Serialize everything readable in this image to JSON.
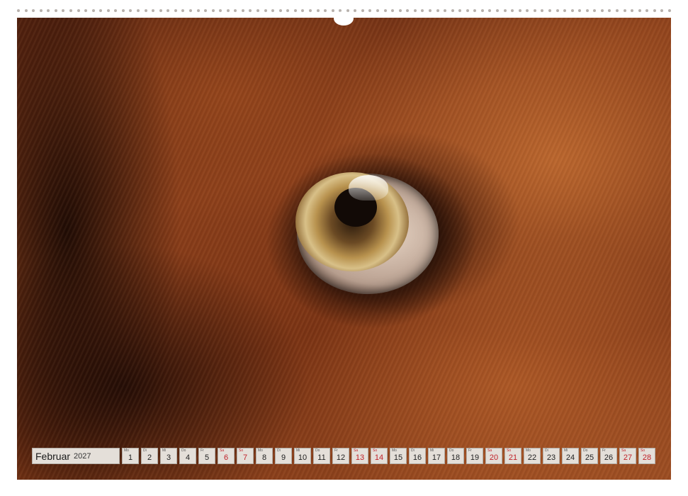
{
  "calendar": {
    "month": "Februar",
    "year": "2027",
    "weekend_color": "#c0222a",
    "days": [
      {
        "wd": "Mo",
        "num": "1",
        "weekend": false
      },
      {
        "wd": "Di",
        "num": "2",
        "weekend": false
      },
      {
        "wd": "Mi",
        "num": "3",
        "weekend": false
      },
      {
        "wd": "Do",
        "num": "4",
        "weekend": false
      },
      {
        "wd": "Fr",
        "num": "5",
        "weekend": false
      },
      {
        "wd": "Sa",
        "num": "6",
        "weekend": true
      },
      {
        "wd": "So",
        "num": "7",
        "weekend": true
      },
      {
        "wd": "Mo",
        "num": "8",
        "weekend": false
      },
      {
        "wd": "Di",
        "num": "9",
        "weekend": false
      },
      {
        "wd": "Mi",
        "num": "10",
        "weekend": false
      },
      {
        "wd": "Do",
        "num": "11",
        "weekend": false
      },
      {
        "wd": "Fr",
        "num": "12",
        "weekend": false
      },
      {
        "wd": "Sa",
        "num": "13",
        "weekend": true
      },
      {
        "wd": "So",
        "num": "14",
        "weekend": true
      },
      {
        "wd": "Mo",
        "num": "15",
        "weekend": false
      },
      {
        "wd": "Di",
        "num": "16",
        "weekend": false
      },
      {
        "wd": "Mi",
        "num": "17",
        "weekend": false
      },
      {
        "wd": "Do",
        "num": "18",
        "weekend": false
      },
      {
        "wd": "Fr",
        "num": "19",
        "weekend": false
      },
      {
        "wd": "Sa",
        "num": "20",
        "weekend": true
      },
      {
        "wd": "So",
        "num": "21",
        "weekend": true
      },
      {
        "wd": "Mo",
        "num": "22",
        "weekend": false
      },
      {
        "wd": "Di",
        "num": "23",
        "weekend": false
      },
      {
        "wd": "Mi",
        "num": "24",
        "weekend": false
      },
      {
        "wd": "Do",
        "num": "25",
        "weekend": false
      },
      {
        "wd": "Fr",
        "num": "26",
        "weekend": false
      },
      {
        "wd": "Sa",
        "num": "27",
        "weekend": true
      },
      {
        "wd": "So",
        "num": "28",
        "weekend": true
      }
    ]
  }
}
